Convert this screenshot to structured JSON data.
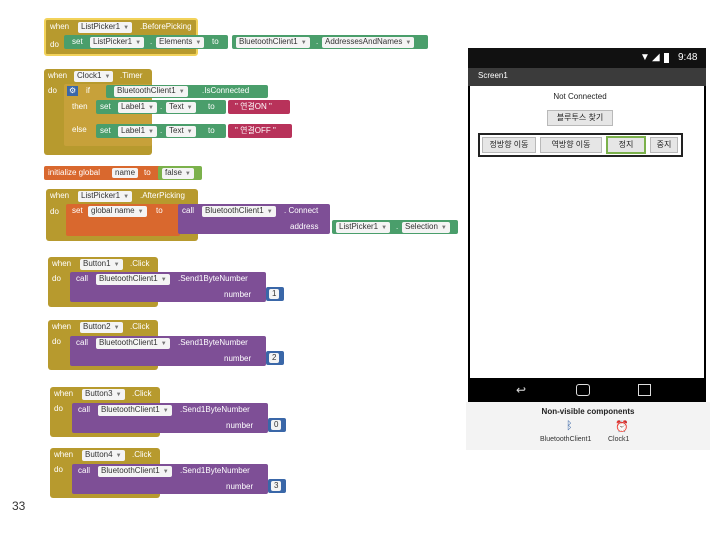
{
  "blocks": {
    "before_picking": {
      "when": "when",
      "component": "ListPicker1",
      "event": ".BeforePicking",
      "do": "do",
      "set": "set",
      "target": "ListPicker1",
      "prop": "Elements",
      "to": "to",
      "source": "BluetoothClient1",
      "source_prop": "AddressesAndNames"
    },
    "timer": {
      "when": "when",
      "component": "Clock1",
      "event": ".Timer",
      "do": "do",
      "if": "if",
      "then": "then",
      "else": "else",
      "is_comp": "BluetoothClient1",
      "is_prop": ".IsConnected",
      "set": "set",
      "label": "Label1",
      "text_prop": "Text",
      "to": "to",
      "text_on": "\" 연결ON \"",
      "text_off": "\" 연결OFF \""
    },
    "init_global": {
      "initialize": "initialize global",
      "name": "name",
      "to": "to",
      "value": "false"
    },
    "after_picking": {
      "when": "when",
      "component": "ListPicker1",
      "event": ".AfterPicking",
      "do": "do",
      "set": "set",
      "var": "global name",
      "to": "to",
      "call": "call",
      "comp": "BluetoothClient1",
      "method": ". Connect",
      "address": "address",
      "sel_comp": "ListPicker1",
      "sel_prop": "Selection"
    },
    "clicks": [
      {
        "when": "when",
        "button": "Button1",
        "event": ".Click",
        "do": "do",
        "call": "call",
        "comp": "BluetoothClient1",
        "method": ".Send1ByteNumber",
        "number_label": "number",
        "value": "1"
      },
      {
        "when": "when",
        "button": "Button2",
        "event": ".Click",
        "do": "do",
        "call": "call",
        "comp": "BluetoothClient1",
        "method": ".Send1ByteNumber",
        "number_label": "number",
        "value": "2"
      },
      {
        "when": "when",
        "button": "Button3",
        "event": ".Click",
        "do": "do",
        "call": "call",
        "comp": "BluetoothClient1",
        "method": ".Send1ByteNumber",
        "number_label": "number",
        "value": "0"
      },
      {
        "when": "when",
        "button": "Button4",
        "event": ".Click",
        "do": "do",
        "call": "call",
        "comp": "BluetoothClient1",
        "method": ".Send1ByteNumber",
        "number_label": "number",
        "value": "3"
      }
    ]
  },
  "slide_number": "33",
  "phone": {
    "time": "9:48",
    "screen_title": "Screen1",
    "status_label": "Not Connected",
    "picker_button": "블루투스 찾기",
    "buttons": [
      "정방향 이동",
      "역방향 이동",
      "정지",
      "중지"
    ],
    "nonvisible_title": "Non-visible components",
    "nonvisible": [
      "BluetoothClient1",
      "Clock1"
    ]
  },
  "colors": {
    "event": "#b79a2e",
    "component": "#4a9e6b",
    "procedure": "#7e4f96",
    "variable": "#d9682e",
    "text": "#b8325a",
    "number": "#3a67a8"
  }
}
